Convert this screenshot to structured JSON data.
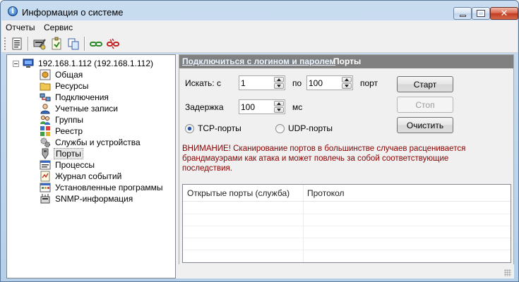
{
  "window": {
    "title": "Информация о системе"
  },
  "menu": {
    "items": [
      "Отчеты",
      "Сервис"
    ]
  },
  "toolbar": {
    "icons": [
      "report-icon",
      "network-settings-icon",
      "export-icon",
      "copy-icon",
      "connect-icon",
      "disconnect-icon"
    ]
  },
  "tree": {
    "root": "192.168.1.112 (192.168.1.112)",
    "items": [
      {
        "label": "Общая",
        "icon": "general-icon"
      },
      {
        "label": "Ресурсы",
        "icon": "folder-icon"
      },
      {
        "label": "Подключения",
        "icon": "connections-icon"
      },
      {
        "label": "Учетные записи",
        "icon": "user-icon"
      },
      {
        "label": "Группы",
        "icon": "group-icon"
      },
      {
        "label": "Реестр",
        "icon": "registry-icon"
      },
      {
        "label": "Службы и устройства",
        "icon": "services-icon"
      },
      {
        "label": "Порты",
        "icon": "port-icon"
      },
      {
        "label": "Процессы",
        "icon": "processes-icon"
      },
      {
        "label": "Журнал событий",
        "icon": "event-log-icon"
      },
      {
        "label": "Установленные программы",
        "icon": "programs-icon"
      },
      {
        "label": "SNMP-информация",
        "icon": "snmp-icon"
      }
    ],
    "selected": "Порты"
  },
  "panel": {
    "connect_link": "Подключиться с логином и паролем",
    "title": "Порты",
    "search_from_label": "Искать: с",
    "from_value": "1",
    "to_label": "по",
    "to_value": "100",
    "port_label": "порт",
    "delay_label": "Задержка",
    "delay_value": "100",
    "ms_label": "мс",
    "tcp_label": "TCP-порты",
    "udp_label": "UDP-порты",
    "tcp_selected": true,
    "start_button": "Старт",
    "stop_button": "Стоп",
    "clear_button": "Очистить",
    "warning": "ВНИМАНИЕ! Сканирование портов в большинстве случаев расценивается брандмауэрами как атака и может повлечь за собой соответствующие последствия.",
    "columns": [
      "Открытые порты (служба)",
      "Протокол"
    ]
  },
  "colors": {
    "warning": "#8b0000",
    "header_bg": "#808080",
    "link": "#e8f4ff"
  }
}
